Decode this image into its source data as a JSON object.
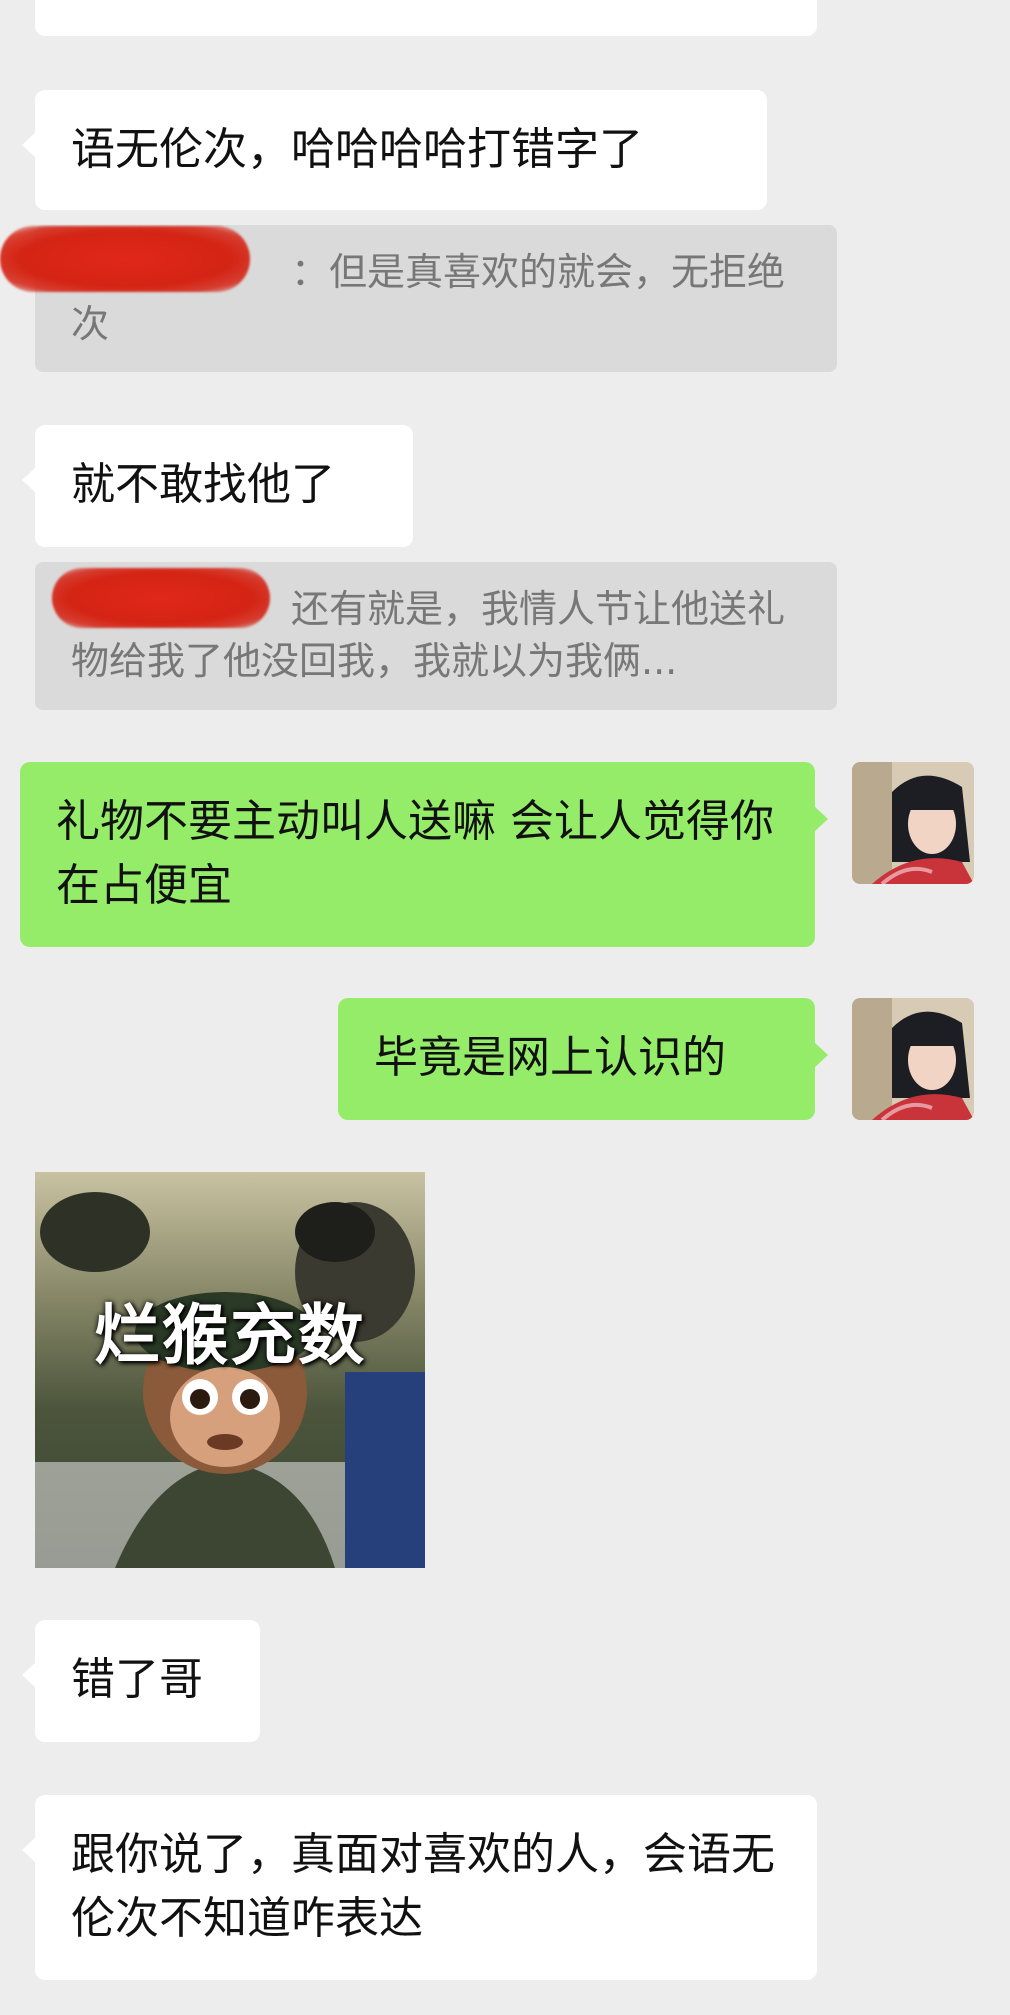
{
  "messages": {
    "m1": "语无伦次，哈哈哈哈打错字了",
    "q1_text": "但是真喜欢的就会，无拒绝次",
    "m2": "就不敢找他了",
    "q2_text": "还有就是，我情人节让他送礼物给我了他没回我，我就以为我俩...",
    "o1": "礼物不要主动叫人送嘛 会让人觉得你在占便宜",
    "o2": "毕竟是网上认识的",
    "sticker_caption": "烂猴充数",
    "m3": "错了哥",
    "m4": "跟你说了，真面对喜欢的人，会语无伦次不知道咋表达"
  },
  "colors": {
    "background": "#ededed",
    "incoming_bubble": "#ffffff",
    "outgoing_bubble": "#95ec69",
    "quote_bg": "#dadada",
    "redaction": "#d42414"
  },
  "icons": {
    "avatar": "user-avatar-photo",
    "sticker": "monkey-soldier-sticker"
  }
}
